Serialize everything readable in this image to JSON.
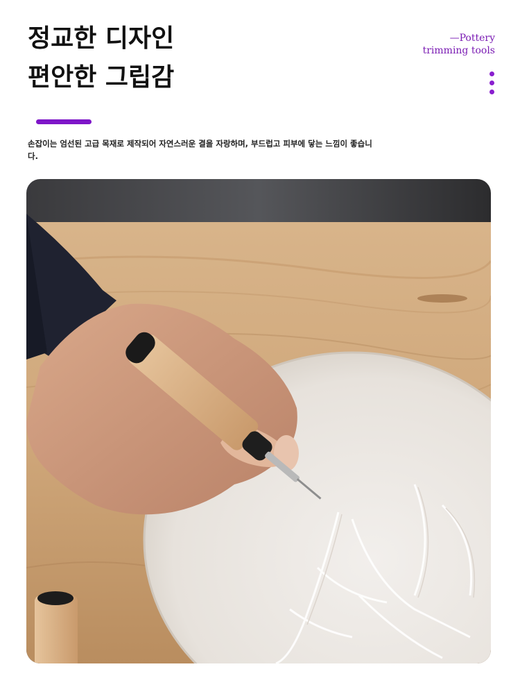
{
  "headline": {
    "line1": "정교한 디자인",
    "line2": "편안한 그립감"
  },
  "side_label": {
    "line1": "—Pottery",
    "line2": "trimming tools"
  },
  "description": "손잡이는 엄선된 고급 목재로 제작되어 자연스러운 결을 자랑하며, 부드럽고 피부에 닿는 느낌이 좋습니다.",
  "colors": {
    "accent": "#7e16c8",
    "label": "#7a1bb3"
  },
  "photo": {
    "subject": "hand carving a design on a clay plate with a wooden-handled needle tool"
  }
}
